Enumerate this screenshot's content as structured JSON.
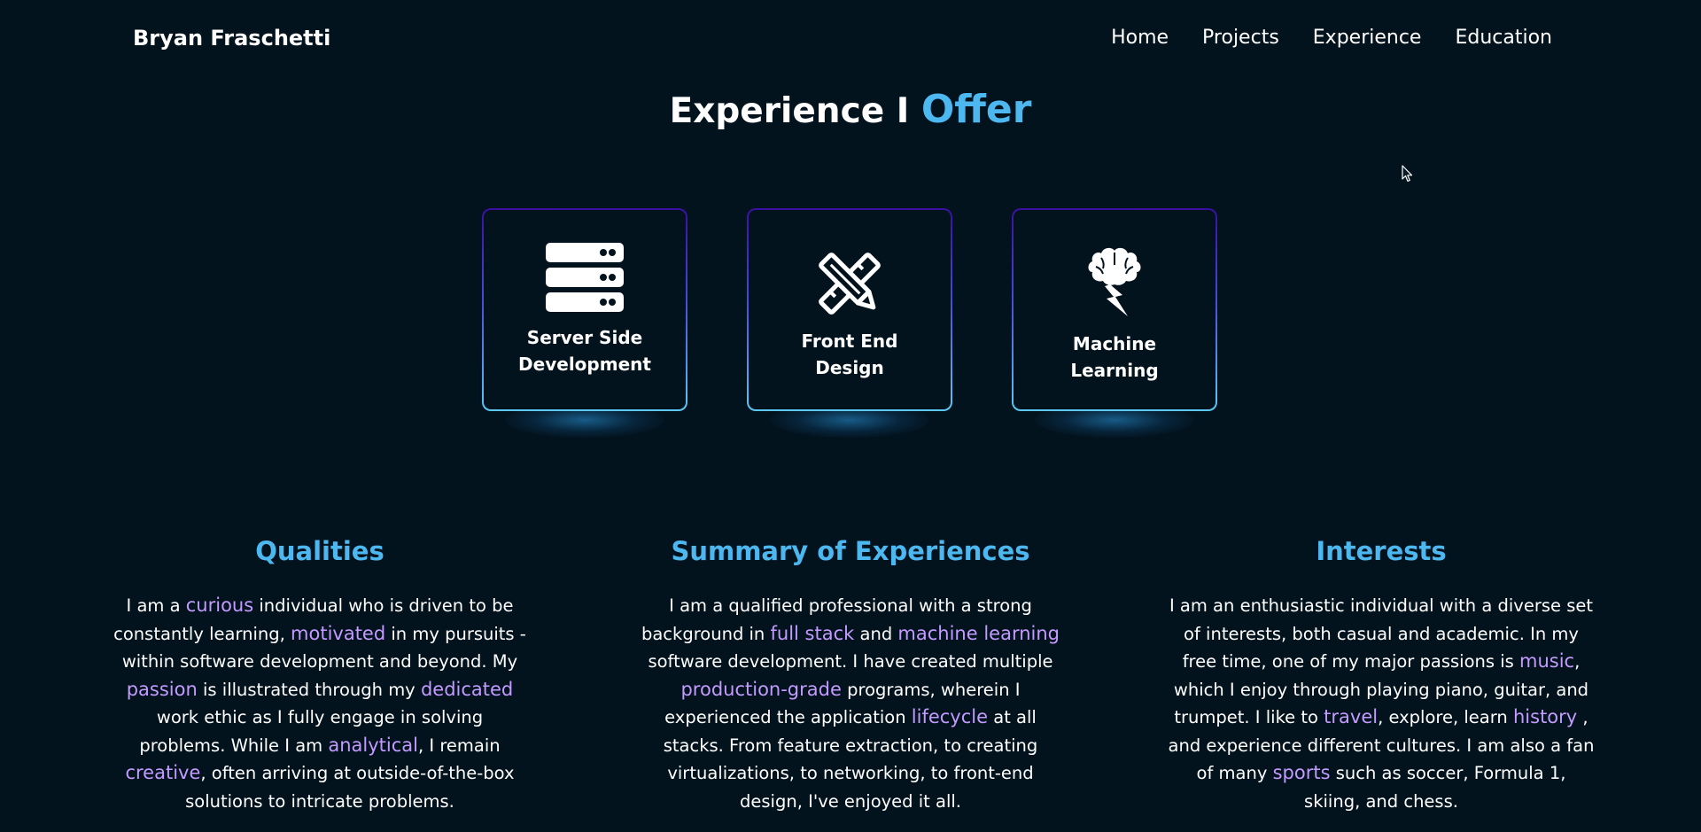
{
  "nav": {
    "brand": "Bryan Fraschetti",
    "links": [
      "Home",
      "Projects",
      "Experience",
      "Education"
    ]
  },
  "section": {
    "title_main": "Experience I ",
    "title_accent": "Offer"
  },
  "cards": [
    {
      "label": "Server Side Development",
      "icon": "server-stack-icon"
    },
    {
      "label": "Front End Design",
      "icon": "pencil-ruler-icon"
    },
    {
      "label": "Machine Learning",
      "icon": "brain-lightning-icon"
    }
  ],
  "columns": {
    "qualities": {
      "title": "Qualities",
      "parts": [
        {
          "t": "I am a "
        },
        {
          "t": "curious",
          "h": true
        },
        {
          "t": " individual who is driven to be constantly learning, "
        },
        {
          "t": "motivated",
          "h": true
        },
        {
          "t": " in my pursuits - within software development and beyond. My "
        },
        {
          "t": "passion",
          "h": true
        },
        {
          "t": " is illustrated through my "
        },
        {
          "t": "dedicated",
          "h": true
        },
        {
          "t": " work ethic as I fully engage in solving problems. While I am "
        },
        {
          "t": "analytical",
          "h": true
        },
        {
          "t": ", I remain "
        },
        {
          "t": "creative",
          "h": true
        },
        {
          "t": ", often arriving at outside-of-the-box solutions to intricate problems."
        }
      ]
    },
    "summary": {
      "title": "Summary of Experiences",
      "parts": [
        {
          "t": "I am a qualified professional with a strong background in "
        },
        {
          "t": "full stack",
          "h": true
        },
        {
          "t": " and "
        },
        {
          "t": "machine learning",
          "h": true
        },
        {
          "t": " software development. I have created multiple "
        },
        {
          "t": "production-grade",
          "h": true
        },
        {
          "t": " programs, wherein I experienced the application "
        },
        {
          "t": "lifecycle",
          "h": true
        },
        {
          "t": " at all stacks. From feature extraction, to creating virtualizations, to networking, to front-end design, I've enjoyed it all."
        }
      ]
    },
    "interests": {
      "title": "Interests",
      "parts": [
        {
          "t": "I am an enthusiastic individual with a diverse set of interests, both casual and academic. In my free time, one of my major passions is "
        },
        {
          "t": "music",
          "h": true
        },
        {
          "t": ", which I enjoy through playing piano, guitar, and trumpet. I like to "
        },
        {
          "t": "travel",
          "h": true
        },
        {
          "t": ", explore, learn "
        },
        {
          "t": "history",
          "h": true
        },
        {
          "t": " , and experience different cultures. I am also a fan of many "
        },
        {
          "t": "sports",
          "h": true
        },
        {
          "t": " such as soccer, Formula 1, skiing, and chess."
        }
      ]
    }
  },
  "colors": {
    "background": "#03131e",
    "accent_blue": "#4db8f0",
    "highlight_purple": "#c39bff"
  }
}
